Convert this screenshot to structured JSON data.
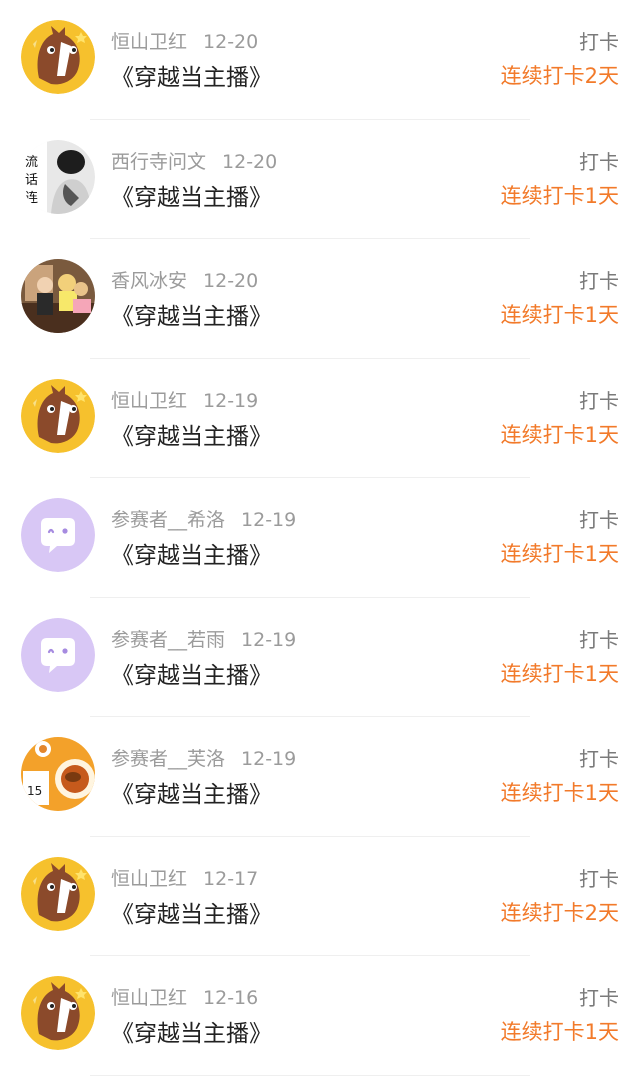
{
  "entries": [
    {
      "user": "恒山卫红",
      "date": "12-20",
      "title": "《穿越当主播》",
      "action": "打卡",
      "streak": "连续打卡2天",
      "avatar_icon": "horse-avatar-icon"
    },
    {
      "user": "西行寺问文",
      "date": "12-20",
      "title": "《穿越当主播》",
      "action": "打卡",
      "streak": "连续打卡1天",
      "avatar_icon": "photo-avatar-icon"
    },
    {
      "user": "香风冰安",
      "date": "12-20",
      "title": "《穿越当主播》",
      "action": "打卡",
      "streak": "连续打卡1天",
      "avatar_icon": "photo-avatar-icon"
    },
    {
      "user": "恒山卫红",
      "date": "12-19",
      "title": "《穿越当主播》",
      "action": "打卡",
      "streak": "连续打卡1天",
      "avatar_icon": "horse-avatar-icon"
    },
    {
      "user": "参赛者__希洛",
      "date": "12-19",
      "title": "《穿越当主播》",
      "action": "打卡",
      "streak": "连续打卡1天",
      "avatar_icon": "chat-bubble-avatar-icon"
    },
    {
      "user": "参赛者__若雨",
      "date": "12-19",
      "title": "《穿越当主播》",
      "action": "打卡",
      "streak": "连续打卡1天",
      "avatar_icon": "chat-bubble-avatar-icon"
    },
    {
      "user": "参赛者__芙洛",
      "date": "12-19",
      "title": "《穿越当主播》",
      "action": "打卡",
      "streak": "连续打卡1天",
      "avatar_icon": "food-photo-avatar-icon"
    },
    {
      "user": "恒山卫红",
      "date": "12-17",
      "title": "《穿越当主播》",
      "action": "打卡",
      "streak": "连续打卡2天",
      "avatar_icon": "horse-avatar-icon"
    },
    {
      "user": "恒山卫红",
      "date": "12-16",
      "title": "《穿越当主播》",
      "action": "打卡",
      "streak": "连续打卡1天",
      "avatar_icon": "horse-avatar-icon"
    }
  ],
  "colors": {
    "streak": "#f27a2a",
    "meta": "#9b9b9b",
    "title": "#222222",
    "avatar_purple": "#d8c7f5",
    "avatar_horse_bg": "#f6c12d"
  }
}
